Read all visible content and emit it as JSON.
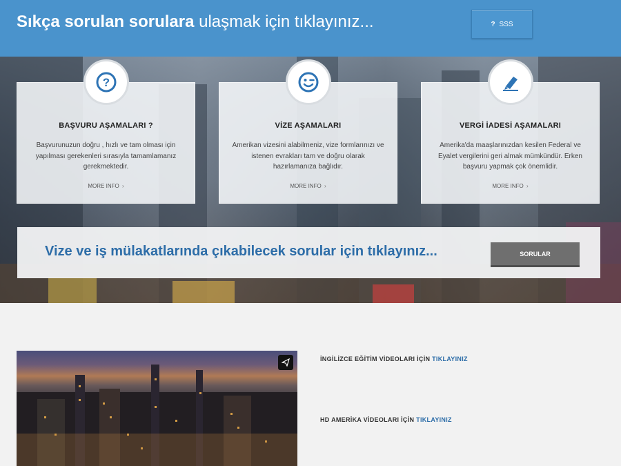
{
  "topbar": {
    "headline_bold": "Sıkça sorulan sorulara",
    "headline_light": "ulaşmak için tıklayınız...",
    "sss_icon": "?",
    "sss_label": "SSS",
    "bg_color": "#4a93cc"
  },
  "cards": [
    {
      "icon": "question-circle-icon",
      "title": "BAŞVURU AŞAMALARI ?",
      "desc": "Başvurunuzun doğru , hızlı ve tam olması için yapılması gerekenleri sırasıyla tamamlamanız gerekmektedir.",
      "more": "MORE INFO",
      "chev": "›"
    },
    {
      "icon": "smile-wink-icon",
      "title": "VİZE AŞAMALARI",
      "desc": "Amerikan vizesini alabilmeniz, vize formlarınızı ve istenen evrakları tam ve doğru olarak hazırlamanıza bağlıdır.",
      "more": "MORE INFO",
      "chev": "›"
    },
    {
      "icon": "pen-icon",
      "title": "VERGİ İADESİ AŞAMALARI",
      "desc": "Amerika'da maaşlarınızdan kesilen Federal ve Eyalet vergilerini geri almak mümkündür. Erken başvuru yapmak çok önemlidir.",
      "more": "MORE INFO",
      "chev": "›"
    }
  ],
  "cta": {
    "text": "Vize ve iş mülakatlarında çıkabilecek sorular için tıklayınız...",
    "button": "SORULAR"
  },
  "links": [
    {
      "prefix": "İNGİLİZCE EĞİTİM VİDEOLARI İÇİN",
      "action": "TIKLAYINIZ"
    },
    {
      "prefix": "HD AMERİKA VİDEOLARI İÇİN",
      "action": "TIKLAYINIZ"
    }
  ],
  "colors": {
    "accent": "#2d6da8",
    "button_gray": "#6f6f6f",
    "icon_blue": "#2e74b5"
  }
}
